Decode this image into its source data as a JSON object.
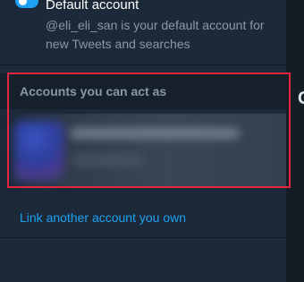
{
  "default_account": {
    "title": "Default account",
    "description": "@eli_eli_san is your default account for new Tweets and searches",
    "toggle_on": true
  },
  "accounts_section": {
    "header": "Accounts you can act as",
    "items": [
      {
        "name": "",
        "avatar": "avatar-icon",
        "redacted": true
      }
    ]
  },
  "link_account": {
    "label": "Link another account you own"
  },
  "right_panel": {
    "partial_glyph": "C"
  },
  "colors": {
    "background": "#15202b",
    "panel": "#1c2938",
    "accent": "#1da1f2",
    "annotation": "#e0273d",
    "muted_text": "#8899a6"
  }
}
